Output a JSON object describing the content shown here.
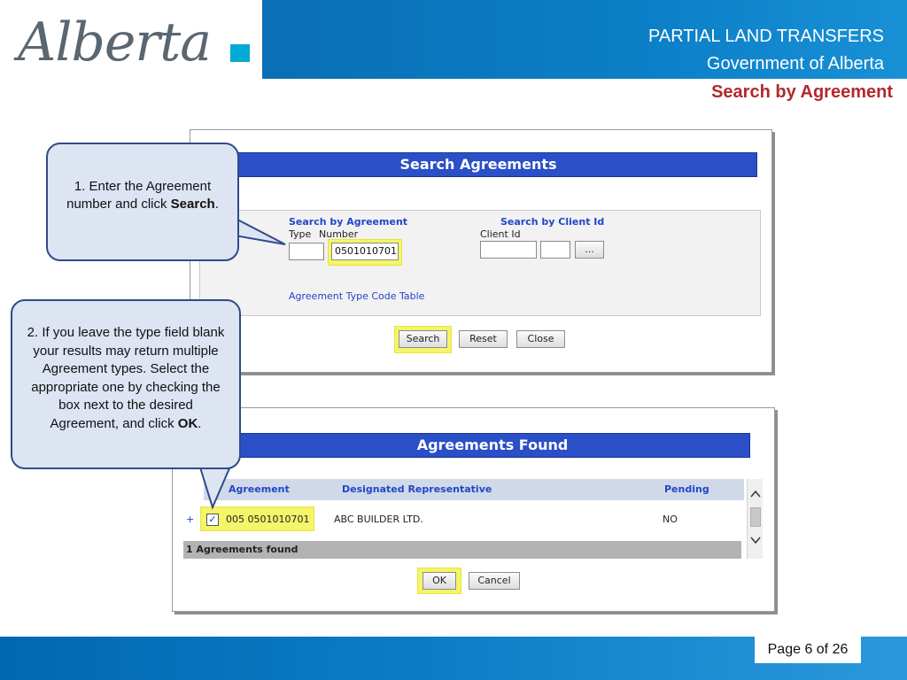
{
  "header": {
    "logo_text": "Alberta",
    "title": "PARTIAL LAND TRANSFERS",
    "subtitle": "Government of Alberta",
    "page_heading": "Search by Agreement"
  },
  "search_panel": {
    "title": "Search Agreements",
    "by_agreement_label": "Search by Agreement",
    "type_label": "Type",
    "number_label": "Number",
    "type_value": "",
    "number_value": "0501010701",
    "by_client_label": "Search by Client Id",
    "client_id_label": "Client Id",
    "client_id_value": "",
    "client_id_value2": "",
    "lookup_button": "...",
    "type_code_link": "Agreement Type Code Table",
    "search_button": "Search",
    "reset_button": "Reset",
    "close_button": "Close"
  },
  "results_panel": {
    "title": "Agreements Found",
    "columns": [
      "Agreement",
      "Designated Representative",
      "Pending"
    ],
    "rows": [
      {
        "expand": "+",
        "checked": "✓",
        "agreement": "005 0501010701",
        "representative": "ABC BUILDER LTD.",
        "pending": "NO"
      }
    ],
    "found_text": "1 Agreements found",
    "ok_button": "OK",
    "cancel_button": "Cancel"
  },
  "callouts": {
    "step1_number": "1.",
    "step1_text": "Enter the Agreement number and click",
    "step1_bold": "Search",
    "step1_end": ".",
    "step2_text": "2. If you leave the type field blank your results may return multiple Agreement types. Select the appropriate one by checking the box next to the desired Agreement, and click",
    "step2_bold": "OK",
    "step2_end": "."
  },
  "footer": {
    "page_label": "Page 6 of 26"
  },
  "colors": {
    "brand_blue": "#0077c0",
    "heading_red": "#b3282d",
    "panel_title_blue": "#2a4fc7",
    "highlight_yellow": "#f4f56a"
  }
}
